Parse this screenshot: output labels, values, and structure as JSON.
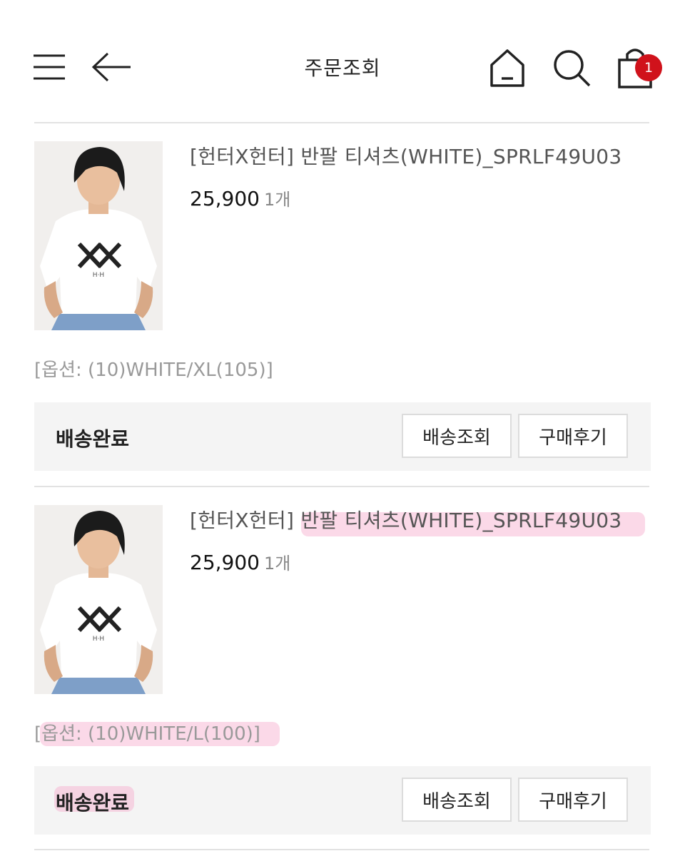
{
  "header": {
    "title": "주문조회",
    "cart_count": "1",
    "icons": [
      "menu-icon",
      "back-arrow-icon",
      "home-icon",
      "search-icon",
      "shopping-bag-icon"
    ]
  },
  "orders": [
    {
      "name": "[헌터X헌터] 반팔 티셔츠(WHITE)_SPRLF49U03",
      "price": "25,900",
      "qty": "1개",
      "option": "[옵션: (10)WHITE/XL(105)]",
      "status": "배송완료",
      "track_label": "배송조회",
      "review_label": "구매후기"
    },
    {
      "name": "[헌터X헌터] 반팔 티셔츠(WHITE)_SPRLF49U03",
      "price": "25,900",
      "qty": "1개",
      "option": "[옵션: (10)WHITE/L(100)]",
      "status": "배송완료",
      "track_label": "배송조회",
      "review_label": "구매후기"
    }
  ],
  "colors": {
    "badge": "#d0121b",
    "highlight": "#f7aacd",
    "status_bar": "#f4f4f4"
  }
}
